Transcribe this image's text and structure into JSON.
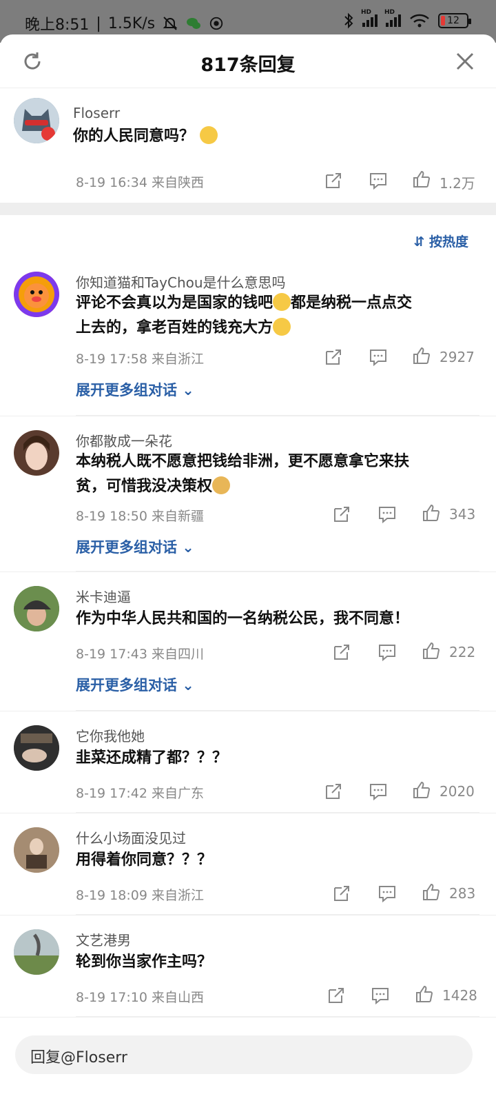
{
  "status": {
    "time": "晚上8:51",
    "net_speed": "1.5K/s",
    "battery": "12"
  },
  "header": {
    "title": "817条回复"
  },
  "root": {
    "name": "Floserr",
    "text": "你的人民同意吗？",
    "meta": "8-19 16:34 来自陕西",
    "likes": "1.2万"
  },
  "sort_label": "按热度",
  "comments": [
    {
      "name": "你知道猫和TayChou是什么意思吗",
      "line1": "评论不会真以为是国家的钱吧",
      "line1b": "都是纳税一点点交",
      "line2": "上去的，拿老百姓的钱充大方",
      "meta": "8-19 17:58 来自浙江",
      "likes": "2927",
      "expand": "展开更多组对话"
    },
    {
      "name": "你都散成一朵花",
      "line1": "本纳税人既不愿意把钱给非洲，更不愿意拿它来扶",
      "line2": "贫，可惜我没决策权",
      "meta": "8-19 18:50 来自新疆",
      "likes": "343",
      "expand": "展开更多组对话"
    },
    {
      "name": "米卡迪逼",
      "line1": "作为中华人民共和国的一名纳税公民，我不同意！",
      "meta": "8-19 17:43 来自四川",
      "likes": "222",
      "expand": "展开更多组对话"
    },
    {
      "name": "它你我他她",
      "line1": "韭菜还成精了都？？？",
      "meta": "8-19 17:42 来自广东",
      "likes": "2020"
    },
    {
      "name": "什么小场面没见过",
      "line1": "用得着你同意？？？",
      "meta": "8-19 18:09 来自浙江",
      "likes": "283"
    },
    {
      "name": "文艺港男",
      "line1": "轮到你当家作主吗？",
      "meta": "8-19 17:10 来自山西",
      "likes": "1428"
    }
  ],
  "reply_placeholder": "回复@Floserr",
  "icons": {
    "refresh": "refresh-icon",
    "close": "close-icon",
    "share": "share-icon",
    "comment": "comment-icon",
    "like": "like-icon"
  }
}
